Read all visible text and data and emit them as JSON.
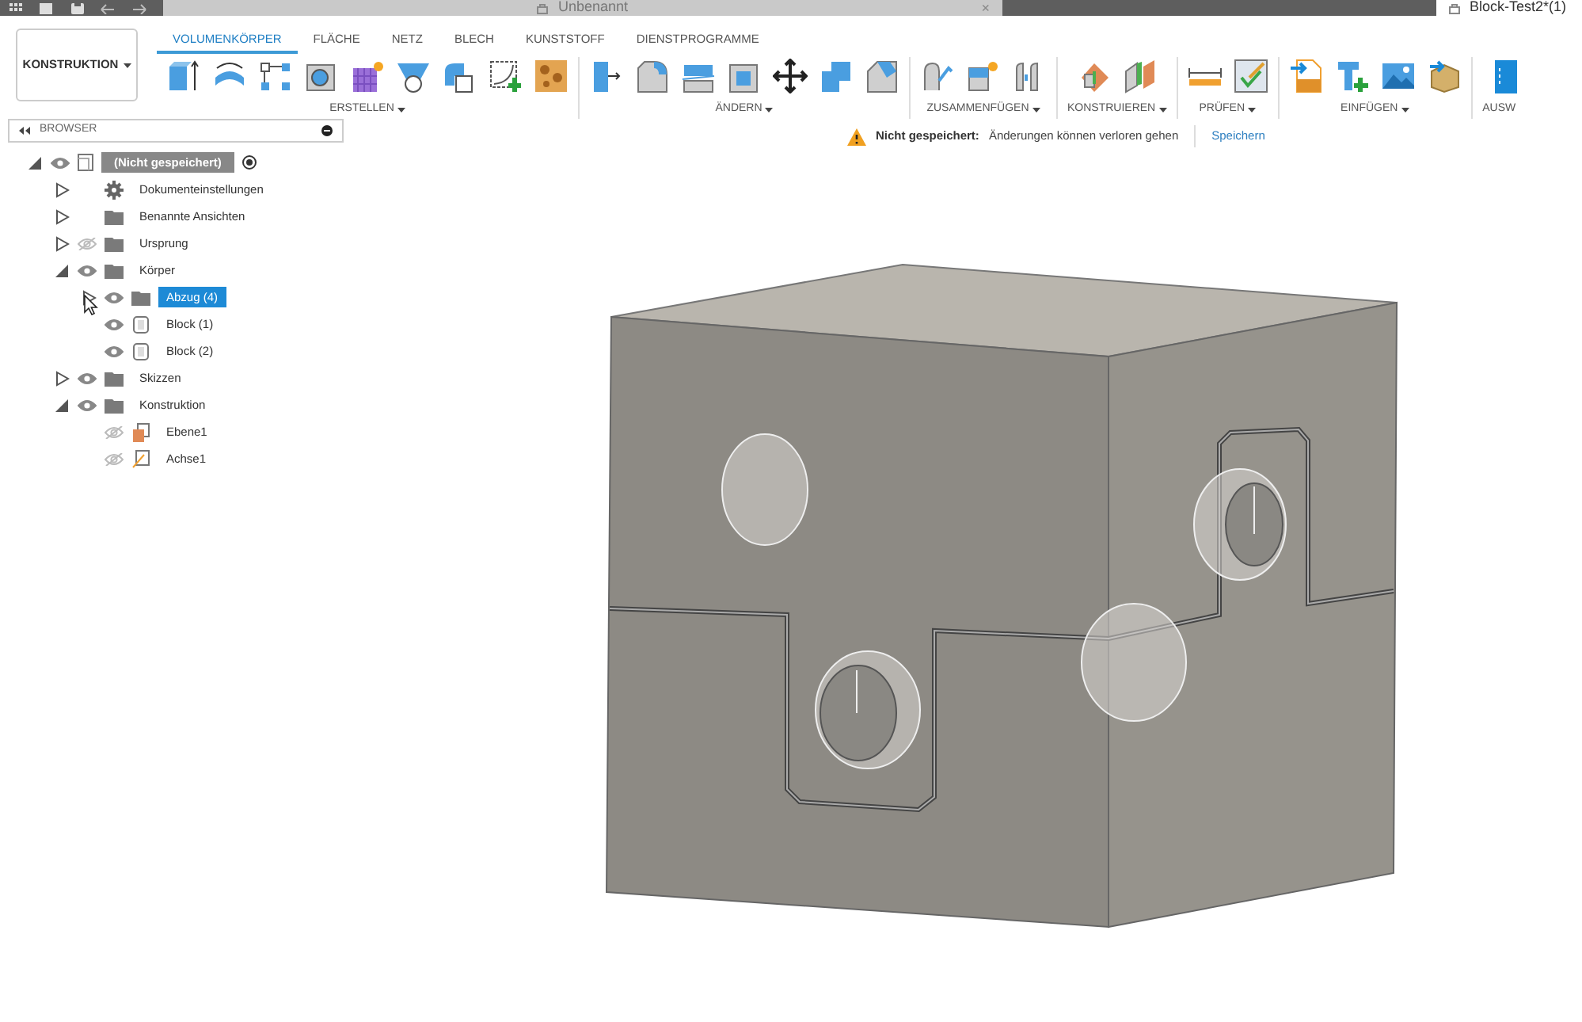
{
  "title_bar": {
    "tabs": [
      {
        "label": "Unbenannt",
        "selected": true,
        "close": "×"
      },
      {
        "label": "Block-Test2*(1)",
        "selected": false
      }
    ]
  },
  "workspace_button": {
    "label": "KONSTRUKTION"
  },
  "ribbon_tabs": [
    {
      "label": "VOLUMENKÖRPER",
      "selected": true
    },
    {
      "label": "FLÄCHE",
      "selected": false
    },
    {
      "label": "NETZ",
      "selected": false
    },
    {
      "label": "BLECH",
      "selected": false
    },
    {
      "label": "KUNSTSTOFF",
      "selected": false
    },
    {
      "label": "DIENSTPROGRAMME",
      "selected": false
    }
  ],
  "tool_groups": [
    {
      "label": "ERSTELLEN"
    },
    {
      "label": "ÄNDERN"
    },
    {
      "label": "ZUSAMMENFÜGEN"
    },
    {
      "label": "KONSTRUIEREN"
    },
    {
      "label": "PRÜFEN"
    },
    {
      "label": "EINFÜGEN"
    },
    {
      "label": "AUSW"
    }
  ],
  "notice": {
    "title": "Nicht gespeichert:",
    "message": "Änderungen können verloren gehen",
    "link": "Speichern"
  },
  "browser": {
    "title": "BROWSER",
    "root": {
      "label": "(Nicht gespeichert)",
      "expanded": true,
      "visible": true,
      "selected": false,
      "children": [
        {
          "label": "Dokumenteinstellungen",
          "kind": "settings",
          "expanded": false,
          "selected": false
        },
        {
          "label": "Benannte Ansichten",
          "kind": "folder",
          "expanded": false,
          "selected": false
        },
        {
          "label": "Ursprung",
          "kind": "folder",
          "expanded": false,
          "visible": false,
          "selected": false
        },
        {
          "label": "Körper",
          "kind": "folder",
          "expanded": true,
          "visible": true,
          "selected": false,
          "children": [
            {
              "label": "Abzug (4)",
              "kind": "folder",
              "expanded": false,
              "visible": true,
              "selected": true
            },
            {
              "label": "Block (1)",
              "kind": "body",
              "visible": true,
              "selected": false
            },
            {
              "label": "Block (2)",
              "kind": "body",
              "visible": true,
              "selected": false
            }
          ]
        },
        {
          "label": "Skizzen",
          "kind": "folder",
          "expanded": false,
          "visible": true,
          "selected": false
        },
        {
          "label": "Konstruktion",
          "kind": "folder",
          "expanded": true,
          "visible": true,
          "selected": false,
          "children": [
            {
              "label": "Ebene1",
              "kind": "plane",
              "visible": false,
              "selected": false
            },
            {
              "label": "Achse1",
              "kind": "axis",
              "visible": false,
              "selected": false
            }
          ]
        }
      ]
    }
  }
}
